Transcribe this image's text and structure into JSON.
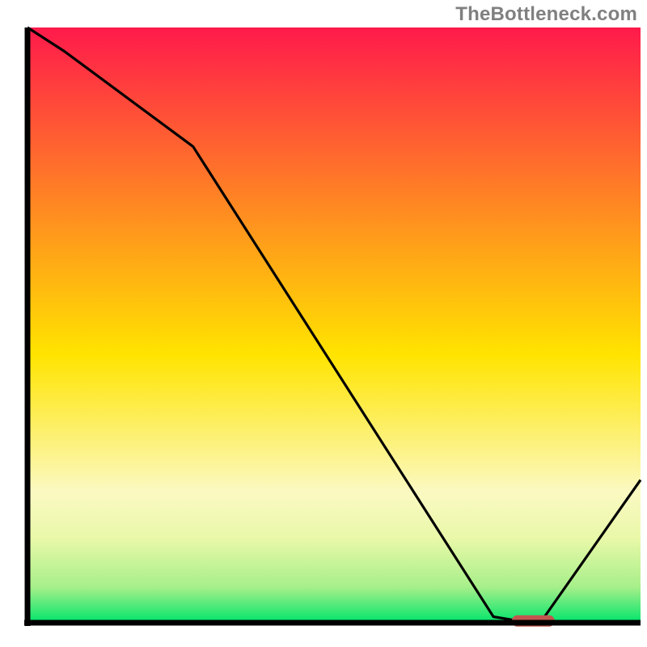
{
  "attribution": "TheBottleneck.com",
  "colors": {
    "axis": "#000000",
    "line": "#000000",
    "marker": "#c1564f",
    "grad_top": "#ff1a4b",
    "grad_mid": "#ffe400",
    "grad_band1": "#fbf9c2",
    "grad_band2": "#e8f8a8",
    "grad_band3": "#a7ef8a",
    "grad_bottom": "#00e56b"
  },
  "chart_data": {
    "type": "line",
    "title": "",
    "xlabel": "",
    "ylabel": "",
    "xlim": [
      0,
      100
    ],
    "ylim": [
      0,
      100
    ],
    "x": [
      0,
      6,
      27,
      76,
      79,
      84,
      100
    ],
    "values": [
      100,
      96,
      80,
      1,
      0.5,
      0.5,
      24
    ],
    "marker": {
      "x_start": 79,
      "x_end": 86,
      "y": 0.3
    }
  }
}
